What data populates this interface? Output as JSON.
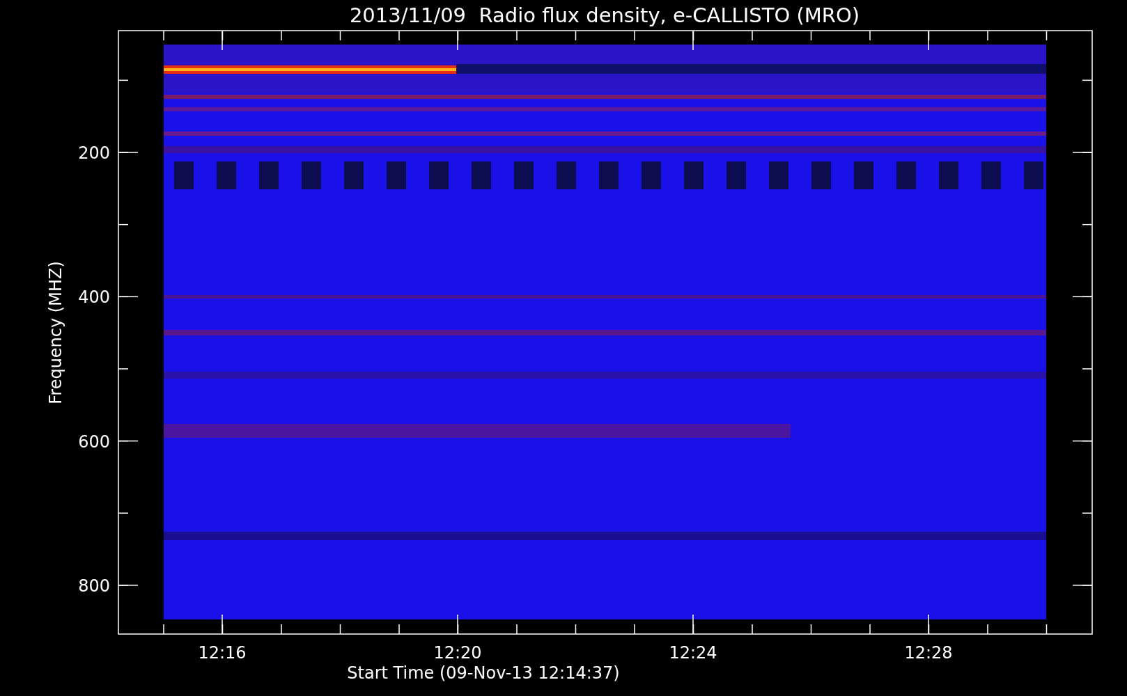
{
  "title": "2013/11/09  Radio flux density, e-CALLISTO (MRO)",
  "y_axis": {
    "label": "Frequency (MHZ)",
    "tick_labels": [
      "200",
      "400",
      "600",
      "800"
    ]
  },
  "x_axis": {
    "label": "Start Time (09-Nov-13 12:14:37)",
    "tick_labels": [
      "12:16",
      "12:20",
      "12:24",
      "12:28"
    ]
  }
}
